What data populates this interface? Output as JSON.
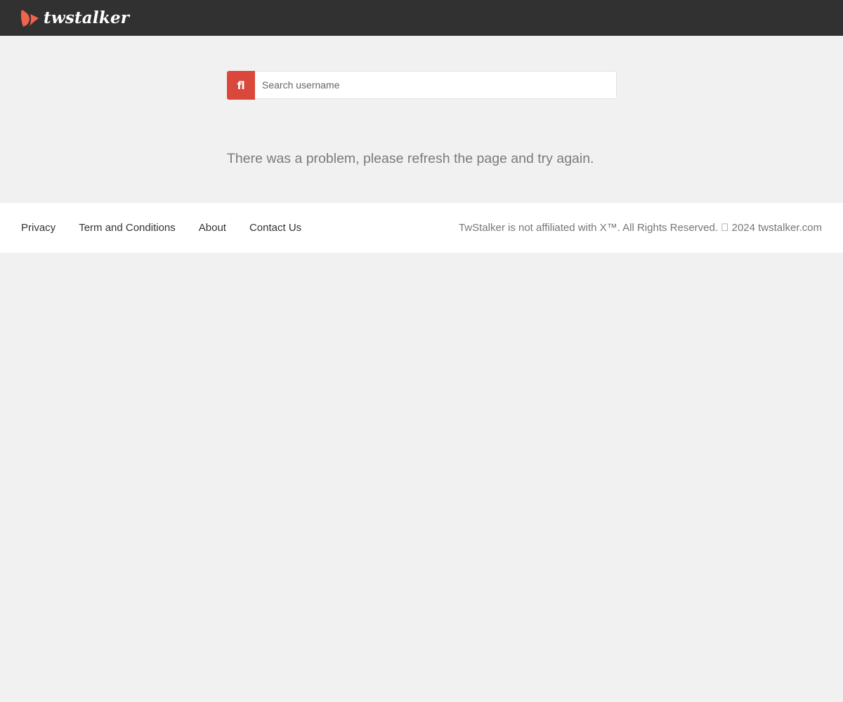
{
  "header": {
    "brand_name": "twstalker",
    "brand_color": "#f0634c"
  },
  "search": {
    "button_glyph": "fl",
    "placeholder": "Search username",
    "value": "",
    "button_color": "#d9483a"
  },
  "main": {
    "error_message": "There was a problem, please refresh the page and try again."
  },
  "footer": {
    "links": [
      {
        "label": "Privacy"
      },
      {
        "label": "Term and Conditions"
      },
      {
        "label": "About"
      },
      {
        "label": "Contact Us"
      }
    ],
    "copyright": "TwStalker is not affiliated with X™. All Rights Reserved.  2024 twstalker.com"
  }
}
